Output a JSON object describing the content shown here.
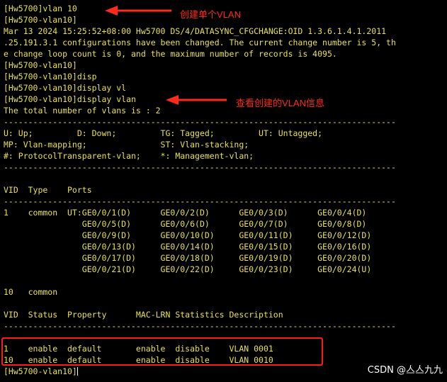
{
  "terminal": {
    "lines": [
      "[Hw5700]vlan 10",
      "[Hw5700-vlan10]",
      "Mar 13 2024 15:25:52+08:00 Hw5700 DS/4/DATASYNC_CFGCHANGE:OID 1.3.6.1.4.1.2011",
      ".25.191.3.1 configurations have been changed. The current change number is 5, th",
      "e change loop count is 0, and the maximum number of records is 4095.",
      "[Hw5700-vlan10]",
      "[Hw5700-vlan10]disp",
      "[Hw5700-vlan10]display vl",
      "[Hw5700-vlan10]display vlan",
      "The total number of vlans is : 2",
      "--------------------------------------------------------------------------------",
      "U: Up;         D: Down;         TG: Tagged;         UT: Untagged;",
      "MP: Vlan-mapping;               ST: Vlan-stacking;",
      "#: ProtocolTransparent-vlan;    *: Management-vlan;",
      "--------------------------------------------------------------------------------",
      "",
      "VID  Type    Ports",
      "--------------------------------------------------------------------------------",
      "1    common  UT:GE0/0/1(D)      GE0/0/2(D)      GE0/0/3(D)      GE0/0/4(D)",
      "                GE0/0/5(D)      GE0/0/6(D)      GE0/0/7(D)      GE0/0/8(D)",
      "                GE0/0/9(D)      GE0/0/10(D)     GE0/0/11(D)     GE0/0/12(D)",
      "                GE0/0/13(D)     GE0/0/14(D)     GE0/0/15(D)     GE0/0/16(D)",
      "                GE0/0/17(D)     GE0/0/18(D)     GE0/0/19(D)     GE0/0/20(D)",
      "                GE0/0/21(D)     GE0/0/22(D)     GE0/0/23(D)     GE0/0/24(U)",
      "",
      "10   common",
      "",
      "VID  Status  Property      MAC-LRN Statistics Description",
      "--------------------------------------------------------------------------------",
      "",
      "1    enable  default       enable  disable    VLAN 0001",
      "10   enable  default       enable  disable    VLAN 0010",
      "[Hw5700-vlan10]"
    ]
  },
  "annotations": {
    "create_vlan": "创建单个VLAN",
    "view_vlan": "查看创建的VLAN信息"
  },
  "watermark": "CSDN @亼亼九九",
  "colors": {
    "background": "#000000",
    "terminal_text": "#e8e04a",
    "annotation": "#ff2a1a"
  }
}
